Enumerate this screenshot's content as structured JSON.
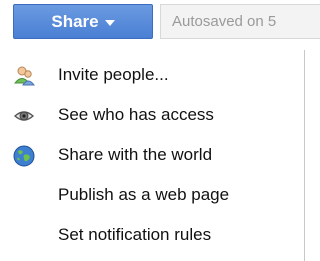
{
  "toolbar": {
    "share_label": "Share",
    "autosave_text": "Autosaved on 5"
  },
  "menu": {
    "items": [
      {
        "label": "Invite people...",
        "icon": "invite-people-icon"
      },
      {
        "label": "See who has access",
        "icon": "eye-icon"
      },
      {
        "label": "Share with the world",
        "icon": "globe-icon"
      },
      {
        "label": "Publish as a web page",
        "icon": ""
      },
      {
        "label": "Set notification rules",
        "icon": ""
      }
    ]
  },
  "colors": {
    "share_button": "#4a7fd4",
    "autosave_bg": "#f3f3f3",
    "autosave_text": "#9a9a9a"
  }
}
